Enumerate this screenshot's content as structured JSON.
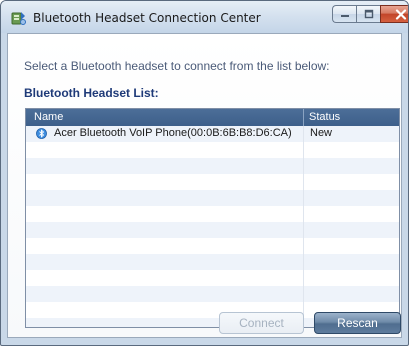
{
  "window": {
    "title": "Bluetooth Headset Connection Center",
    "icon": "bluetooth-app-icon"
  },
  "caption_buttons": {
    "minimize_icon": "minimize-icon",
    "maximize_icon": "maximize-icon",
    "close_icon": "close-icon"
  },
  "content": {
    "instruction": "Select a Bluetooth headset to connect from the list below:",
    "list_heading": "Bluetooth Headset List:"
  },
  "list": {
    "columns": [
      "Name",
      "Status"
    ],
    "rows": [
      {
        "name": "Acer Bluetooth VoIP Phone(00:0B:6B:B8:D6:CA)",
        "status": "New",
        "icon": "bluetooth-device-icon"
      }
    ]
  },
  "buttons": {
    "connect": "Connect",
    "connect_enabled": false,
    "rescan": "Rescan"
  },
  "colors": {
    "list_header": "#3d5f8a",
    "heading_text": "#1e3a78",
    "instruction_text": "#4a5a78",
    "close_button": "#c2452a"
  }
}
